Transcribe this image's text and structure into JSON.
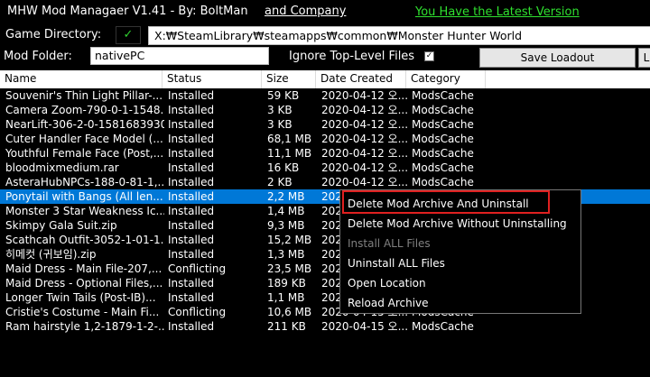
{
  "header": {
    "app_title": "MHW Mod Managaer V1.41 - By: BoltMan",
    "company_link": "and Company",
    "latest_version": "You Have the Latest Version"
  },
  "settings": {
    "game_dir_label": "Game Directory:",
    "dir_check": "✓",
    "game_dir_value": "X:₩SteamLibrary₩steamapps₩common₩Monster Hunter World",
    "mod_folder_label": "Mod Folder:",
    "mod_folder_value": "nativePC",
    "ignore_label": "Ignore Top-Level Files",
    "ignore_checked": "✓",
    "save_loadout": "Save Loadout",
    "right_button": "L"
  },
  "table": {
    "columns": [
      "Name",
      "Status",
      "Size",
      "Date Created",
      "Category"
    ],
    "rows": [
      {
        "name": "Souvenir's Thin Light Pillar-...",
        "status": "Installed",
        "size": "59 KB",
        "date": "2020-04-12 오...",
        "category": "ModsCache"
      },
      {
        "name": "Camera Zoom-790-0-1-1548...",
        "status": "Installed",
        "size": "3 KB",
        "date": "2020-04-12 오...",
        "category": "ModsCache"
      },
      {
        "name": "NearLift-306-2-0-1581683930...",
        "status": "Installed",
        "size": "3 KB",
        "date": "2020-04-12 오...",
        "category": "ModsCache"
      },
      {
        "name": "Cuter Handler Face Model (...",
        "status": "Installed",
        "size": "68,1 MB",
        "date": "2020-04-12 오...",
        "category": "ModsCache"
      },
      {
        "name": "Youthful Female Face (Post,...",
        "status": "Installed",
        "size": "11,1 MB",
        "date": "2020-04-12 오...",
        "category": "ModsCache"
      },
      {
        "name": "bloodmixmedium.rar",
        "status": "Installed",
        "size": "16 KB",
        "date": "2020-04-12 오...",
        "category": "ModsCache"
      },
      {
        "name": "AsteraHubNPCs-188-0-81-1,...",
        "status": "Installed",
        "size": "2 KB",
        "date": "2020-04-12 오...",
        "category": "ModsCache"
      },
      {
        "name": "Ponytail with Bangs (All len...",
        "status": "Installed",
        "size": "2,2 MB",
        "date": "202",
        "category": ""
      },
      {
        "name": "Monster 3 Star Weakness Ic...",
        "status": "Installed",
        "size": "1,4 MB",
        "date": "202",
        "category": ""
      },
      {
        "name": "Skimpy Gala Suit.zip",
        "status": "Installed",
        "size": "9,3 MB",
        "date": "202",
        "category": ""
      },
      {
        "name": "Scathcah Outfit-3052-1-01-1...",
        "status": "Installed",
        "size": "15,2 MB",
        "date": "202",
        "category": ""
      },
      {
        "name": "히메컷 (귀보임).zip",
        "status": "Installed",
        "size": "1,3 MB",
        "date": "202",
        "category": ""
      },
      {
        "name": "Maid Dress - Main File-207,...",
        "status": "Conflicting",
        "size": "23,5 MB",
        "date": "202",
        "category": ""
      },
      {
        "name": "Maid Dress - Optional Files,...",
        "status": "Installed",
        "size": "189 KB",
        "date": "202",
        "category": ""
      },
      {
        "name": "Longer Twin Tails (Post-IB)...",
        "status": "Installed",
        "size": "1,1 MB",
        "date": "202",
        "category": ""
      },
      {
        "name": "Cristie's Costume - Main Fi...",
        "status": "Conflicting",
        "size": "10,6 MB",
        "date": "2020-04-15 오...",
        "category": "ModsCache"
      },
      {
        "name": "Ram hairstyle 1,2-1879-1-2-...",
        "status": "Installed",
        "size": "211 KB",
        "date": "2020-04-15 오...",
        "category": "ModsCache"
      }
    ]
  },
  "context_menu": {
    "items": [
      {
        "label": "Delete Mod Archive And Uninstall",
        "enabled": true
      },
      {
        "label": "Delete Mod Archive Without Uninstalling",
        "enabled": true
      },
      {
        "label": "Install ALL Files",
        "enabled": false
      },
      {
        "label": "Uninstall ALL Files",
        "enabled": true
      },
      {
        "label": "Open Location",
        "enabled": true
      },
      {
        "label": "Reload Archive",
        "enabled": true
      }
    ]
  },
  "colors": {
    "selection": "#0078d7",
    "highlight_box": "#e02020",
    "latest_link": "#2fe02f"
  }
}
